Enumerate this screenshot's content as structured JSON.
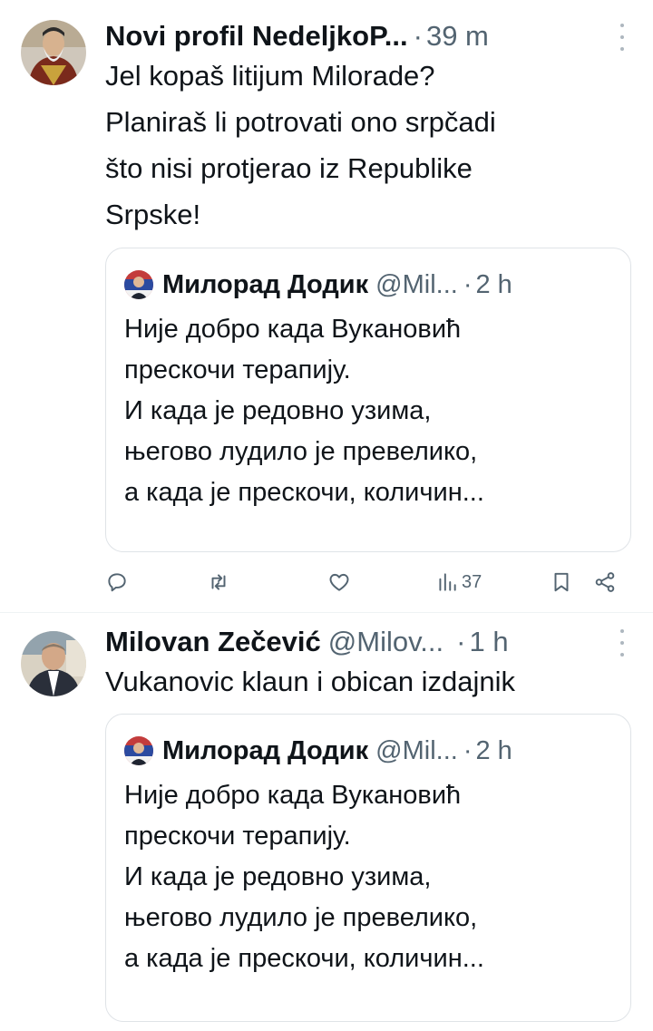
{
  "tweets": [
    {
      "author_name": "Novi profil NedeljkoP...",
      "handle": "",
      "separator": "·",
      "time": "39 m",
      "text": "Jel kopaš litijum Milorade?\nPlaniraš li potrovati ono srpčadi\nšto nisi protjerao iz Republike\nSrpske!",
      "quote": {
        "author_name": "Милорад Додик",
        "handle": "@Mil...",
        "separator": "·",
        "time": "2 h",
        "text": "Није добро када Вукановић\nпрескочи терапију.\nИ када је редовно узима,\nњегово лудило је превелико,\nа када је прескочи, количин..."
      },
      "actions": {
        "views": "37"
      }
    },
    {
      "author_name": "Milovan Zečević",
      "handle": "@Milov...",
      "separator": "·",
      "time": "1 h",
      "text": "Vukanovic klaun i obican izdajnik",
      "quote": {
        "author_name": "Милорад Додик",
        "handle": "@Mil...",
        "separator": "·",
        "time": "2 h",
        "text": "Није добро када Вукановић\nпрескочи терапију.\nИ када је редовно узима,\nњегово лудило је превелико,\nа када је прескочи, количин..."
      }
    }
  ],
  "icons": {
    "reply": "reply-icon",
    "retweet": "retweet-icon",
    "like": "heart-icon",
    "views": "views-icon",
    "bookmark": "bookmark-icon",
    "share": "share-icon",
    "more": "more-dots-icon"
  },
  "colors": {
    "text": "#0f1419",
    "secondary": "#536471",
    "border": "#dfe3e7"
  }
}
